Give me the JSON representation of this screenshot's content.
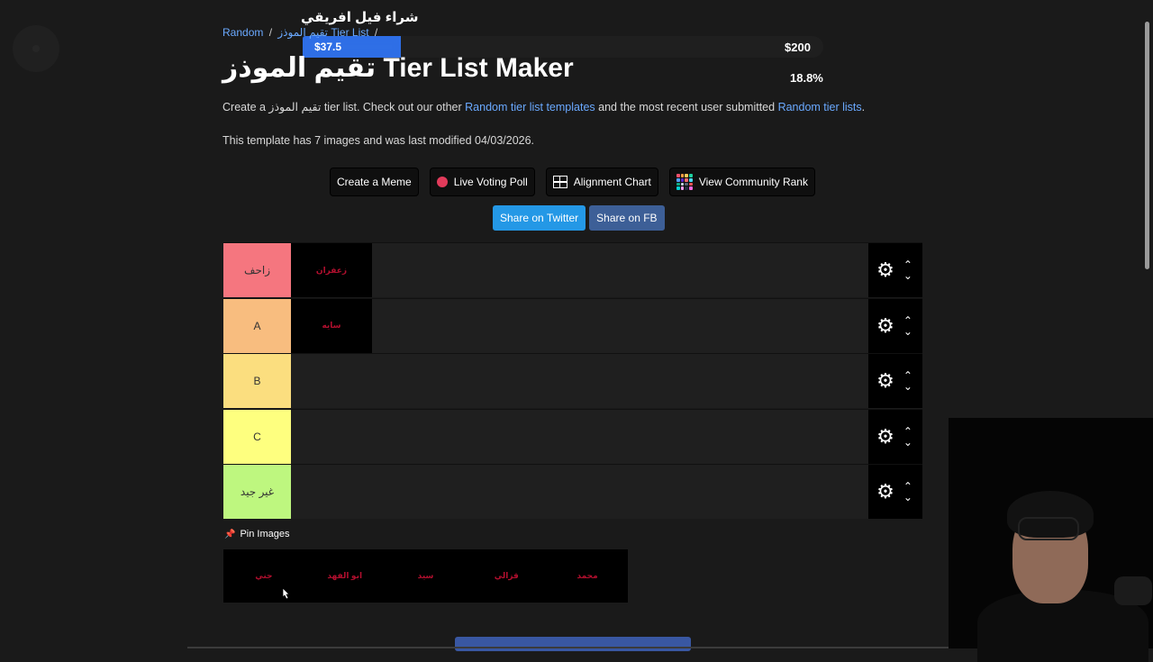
{
  "donation": {
    "title": "شراء فيل افريقي",
    "amount": "$37.5",
    "goal": "$200",
    "percent_text": "18.8%",
    "progress": 0.188,
    "fill_color": "#2f6fe6"
  },
  "breadcrumb": {
    "parent": "Random",
    "current": "تقيم الموذز Tier List",
    "sep": "/"
  },
  "page": {
    "title": "تقيم الموذز Tier List Maker",
    "intro": {
      "prefix": "Create a ",
      "name": "تقيم الموذز",
      "middle": " tier list. Check out our other ",
      "link_templates": "Random tier list templates",
      "between": " and the most recent user submitted ",
      "link_lists": "Random tier lists",
      "suffix": "."
    },
    "meta": "This template has 7 images and was last modified 04/03/2026."
  },
  "actions": {
    "create_meme": "Create a Meme",
    "live_poll": "Live Voting Poll",
    "alignment": "Alignment Chart",
    "community_rank": "View Community Rank"
  },
  "share": {
    "twitter": "Share on Twitter",
    "facebook": "Share on FB"
  },
  "tiers": [
    {
      "label": "زاحف",
      "color": "#f5767f",
      "items": [
        "زعفران"
      ]
    },
    {
      "label": "A",
      "color": "#f8bd7f",
      "items": [
        "سايه"
      ]
    },
    {
      "label": "B",
      "color": "#fbde7f",
      "items": []
    },
    {
      "label": "C",
      "color": "#feff7f",
      "items": []
    },
    {
      "label": "غير جيد",
      "color": "#bef77f",
      "items": []
    }
  ],
  "pin": {
    "label": "Pin Images"
  },
  "pool": {
    "items": [
      "جني",
      "ابو الفهد",
      "سيد",
      "قزالي",
      "محمد"
    ]
  }
}
